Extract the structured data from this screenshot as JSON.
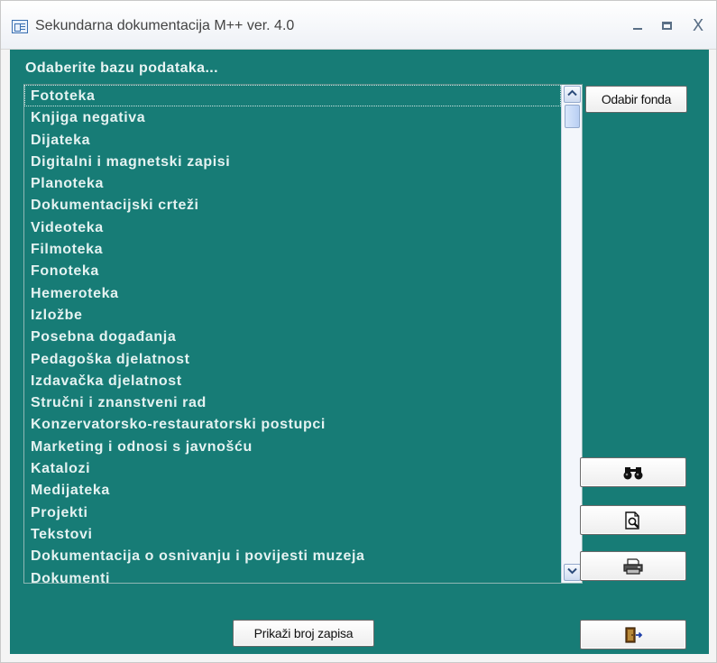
{
  "window": {
    "title": "Sekundarna dokumentacija M++ ver. 4.0",
    "minimize": "_",
    "maximize": "",
    "close": "X"
  },
  "form": {
    "prompt": "Odaberite bazu podataka...",
    "background_color": "#177c76"
  },
  "database_list": {
    "selected_index": 0,
    "items": [
      "Fototeka",
      "Knjiga negativa",
      "Dijateka",
      "Digitalni i magnetski zapisi",
      "Planoteka",
      "Dokumentacijski crteži",
      "Videoteka",
      "Filmoteka",
      "Fonoteka",
      "Hemeroteka",
      "Izložbe",
      "Posebna događanja",
      "Pedagoška djelatnost",
      "Izdavačka djelatnost",
      "Stručni i znanstveni rad",
      "Konzervatorsko-restauratorski postupci",
      "Marketing i odnosi s javnošću",
      "Katalozi",
      "Medijateka",
      "Projekti",
      "Tekstovi",
      "Dokumentacija o osnivanju i povijesti muzeja",
      "Dokumenti"
    ]
  },
  "buttons": {
    "choose_fund": "Odabir fonda",
    "show_record_count": "Prikaži broj zapisa",
    "find_icon": "binoculars-icon",
    "preview_icon": "print-preview-icon",
    "print_icon": "printer-icon",
    "exit_icon": "exit-door-icon"
  }
}
